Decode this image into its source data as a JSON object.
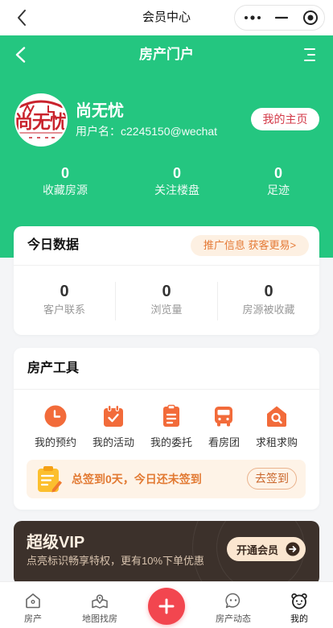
{
  "topbar": {
    "title": "会员中心",
    "back_icon": "chevron-left-icon",
    "capsule_icons": [
      "more-dots-icon",
      "minimize-icon",
      "target-icon"
    ]
  },
  "header": {
    "title": "房产门户",
    "back_icon": "chevron-left-icon",
    "menu_icon": "menu-icon",
    "profile": {
      "avatar_logo_text": "尚无忧",
      "name": "尚无忧",
      "username": "用户名：c2245150@wechat",
      "homepage_button": "我的主页"
    },
    "stats": [
      {
        "value": "0",
        "label": "收藏房源"
      },
      {
        "value": "0",
        "label": "关注楼盘"
      },
      {
        "value": "0",
        "label": "足迹"
      }
    ]
  },
  "today": {
    "title": "今日数据",
    "promo": "推广信息 获客更易>",
    "stats": [
      {
        "value": "0",
        "label": "客户联系"
      },
      {
        "value": "0",
        "label": "浏览量"
      },
      {
        "value": "0",
        "label": "房源被收藏"
      }
    ]
  },
  "tools": {
    "title": "房产工具",
    "items": [
      {
        "label": "我的预约",
        "icon": "clock-icon"
      },
      {
        "label": "我的活动",
        "icon": "calendar-check-icon"
      },
      {
        "label": "我的委托",
        "icon": "document-icon"
      },
      {
        "label": "看房团",
        "icon": "bus-icon"
      },
      {
        "label": "求租求购",
        "icon": "house-search-icon"
      }
    ],
    "signin": {
      "icon": "clipboard-icon",
      "text": "总签到0天，今日还未签到",
      "button": "去签到"
    }
  },
  "vip": {
    "title": "超级VIP",
    "subtitle": "点亮标识畅享特权，更有10%下单优惠",
    "button": "开通会员",
    "button_icon": "arrow-right-circle-icon"
  },
  "tabbar": {
    "items": [
      {
        "label": "房产",
        "icon": "house-icon",
        "active": false
      },
      {
        "label": "地图找房",
        "icon": "map-pin-icon",
        "active": false
      },
      {
        "label": "房产动态",
        "icon": "chat-bubble-icon",
        "active": false
      },
      {
        "label": "我的",
        "icon": "bear-face-icon",
        "active": true
      }
    ],
    "center_action": {
      "icon": "plus-icon"
    }
  },
  "colors": {
    "brand_green": "#24c680",
    "accent_orange": "#f26b3a",
    "page_bg": "#f4f5f7",
    "vip_bg": "#3c312b",
    "action_red": "#f2464f",
    "homepage_text": "#d33a48"
  }
}
